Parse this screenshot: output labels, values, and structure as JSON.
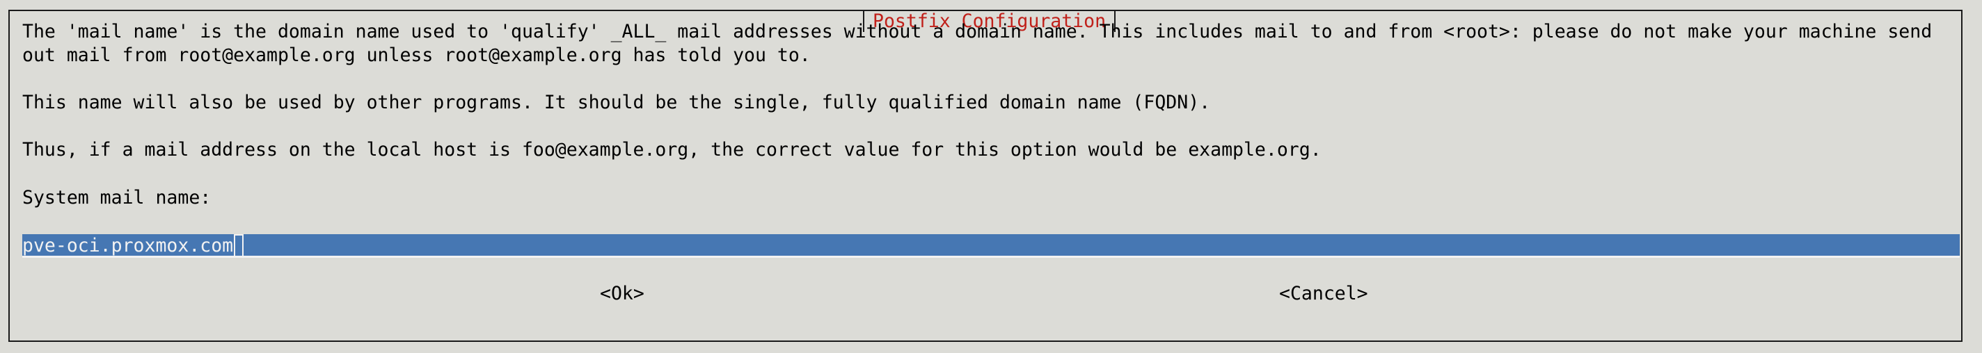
{
  "dialog": {
    "title": "Postfix Configuration",
    "lines": [
      "The 'mail name' is the domain name used to 'qualify' _ALL_ mail addresses without a domain name. This includes mail to and from <root>: please do not make your machine send",
      "out mail from root@example.org unless root@example.org has told you to.",
      "This name will also be used by other programs. It should be the single, fully qualified domain name (FQDN).",
      "Thus, if a mail address on the local host is foo@example.org, the correct value for this option would be example.org.",
      "System mail name:"
    ],
    "input_value": "pve-oci.proxmox.com",
    "ok_label": "<Ok>",
    "cancel_label": "<Cancel>"
  },
  "colors": {
    "background": "#dcdcd7",
    "title": "#c0201a",
    "input_bg": "#4677b3",
    "input_text": "#f2f2f2"
  }
}
